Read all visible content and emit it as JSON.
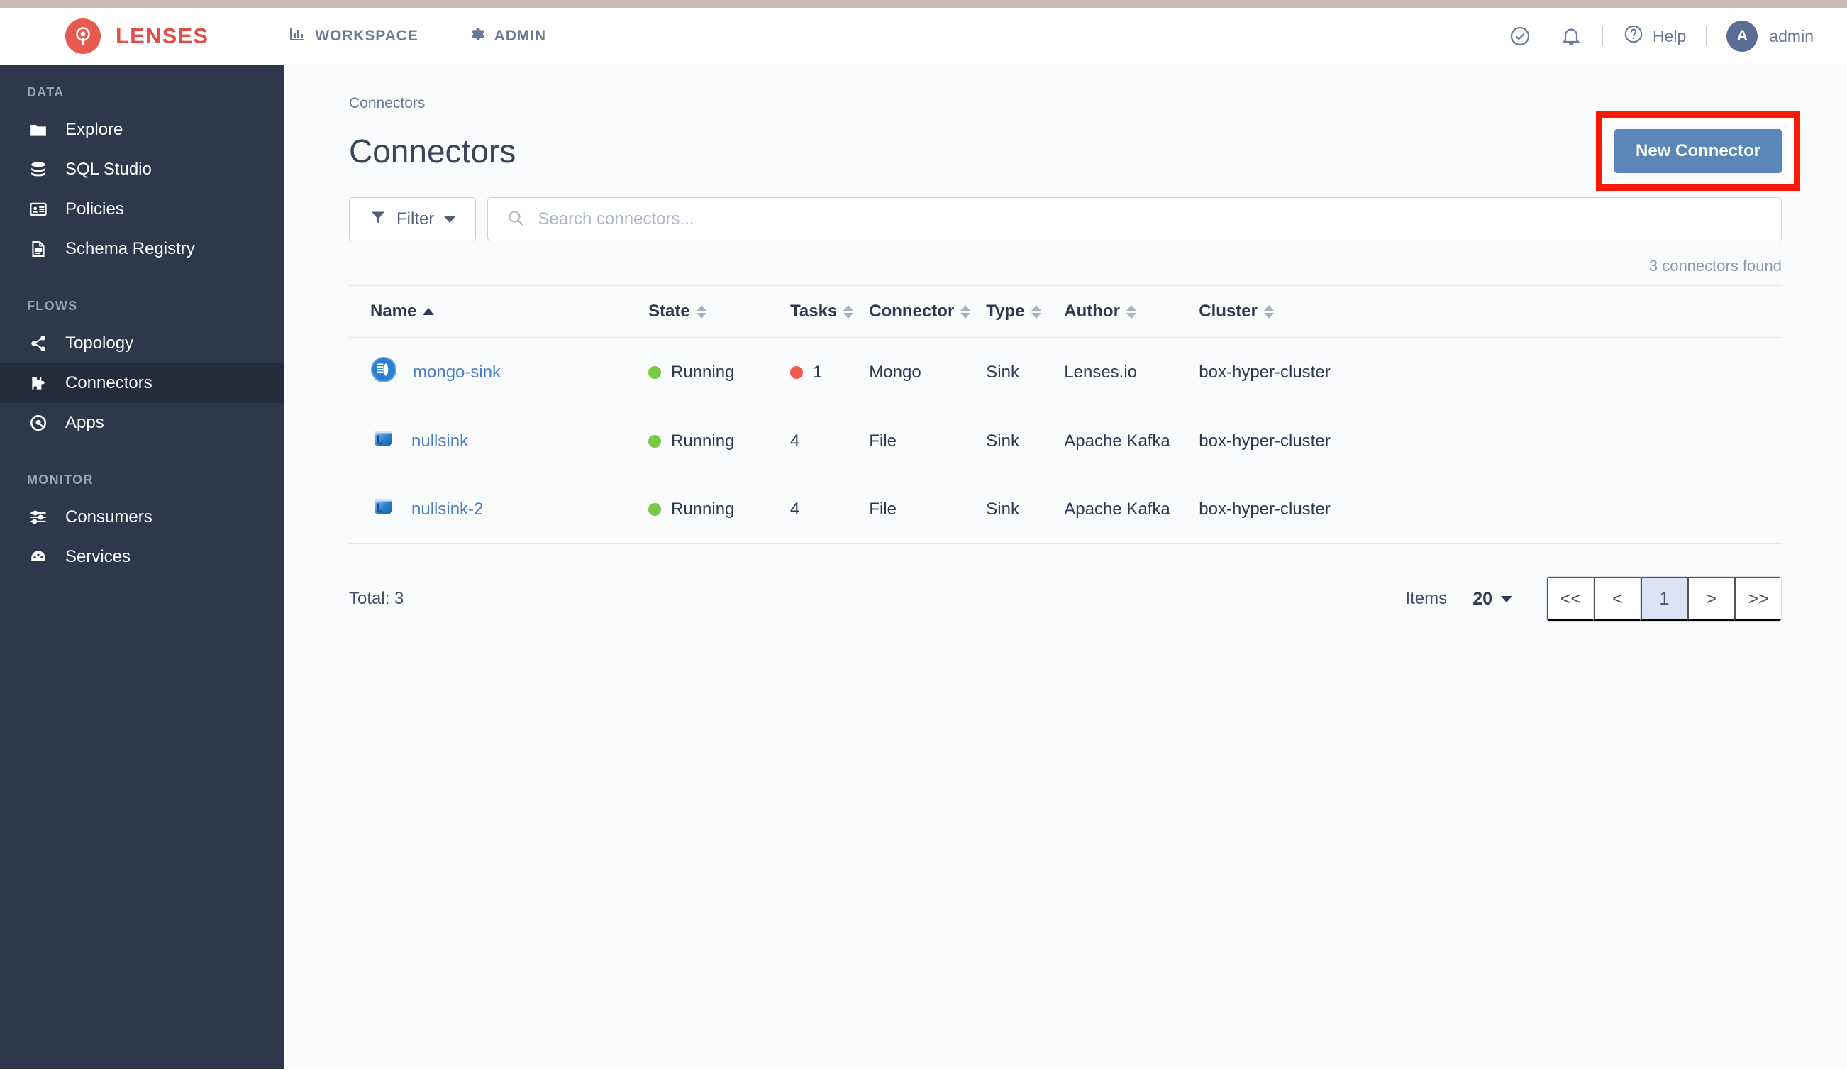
{
  "app": {
    "brand_name": "LENSES",
    "logo_icon": "lens-logo-icon",
    "brand_color": "#e0504a"
  },
  "header": {
    "nav": [
      {
        "label": "WORKSPACE",
        "icon": "bar-chart-icon"
      },
      {
        "label": "ADMIN",
        "icon": "gear-icon"
      }
    ],
    "status_icon": "check-circle-icon",
    "notifications_icon": "bell-icon",
    "help_label": "Help",
    "help_icon": "question-circle-icon",
    "user": {
      "initial": "A",
      "name": "admin"
    }
  },
  "sidebar": {
    "groups": [
      {
        "label": "DATA",
        "items": [
          {
            "label": "Explore",
            "icon": "folder-icon",
            "active": false
          },
          {
            "label": "SQL Studio",
            "icon": "database-icon",
            "active": false
          },
          {
            "label": "Policies",
            "icon": "id-card-icon",
            "active": false
          },
          {
            "label": "Schema Registry",
            "icon": "document-icon",
            "active": false
          }
        ]
      },
      {
        "label": "FLOWS",
        "items": [
          {
            "label": "Topology",
            "icon": "share-network-icon",
            "active": false
          },
          {
            "label": "Connectors",
            "icon": "puzzle-piece-icon",
            "active": true
          },
          {
            "label": "Apps",
            "icon": "apps-circle-icon",
            "active": false
          }
        ]
      },
      {
        "label": "MONITOR",
        "items": [
          {
            "label": "Consumers",
            "icon": "sliders-icon",
            "active": false
          },
          {
            "label": "Services",
            "icon": "gauge-icon",
            "active": false
          }
        ]
      }
    ]
  },
  "main": {
    "breadcrumb": "Connectors",
    "page_title": "Connectors",
    "new_connector_label": "New Connector",
    "new_connector_color": "#5b87b8",
    "annotation_color": "#fc1905",
    "filter_label": "Filter",
    "search_placeholder": "Search connectors...",
    "search_value": "",
    "found_text": "3 connectors found",
    "table": {
      "columns": [
        {
          "label": "Name",
          "sort": "asc"
        },
        {
          "label": "State",
          "sort": "none"
        },
        {
          "label": "Tasks",
          "sort": "none"
        },
        {
          "label": "Connector",
          "sort": "none"
        },
        {
          "label": "Type",
          "sort": "none"
        },
        {
          "label": "Author",
          "sort": "none"
        },
        {
          "label": "Cluster",
          "sort": "none"
        }
      ],
      "rows": [
        {
          "icon": "mongodb-connector-icon",
          "name": "mongo-sink",
          "state": "Running",
          "state_color": "#7ac943",
          "tasks": "1",
          "tasks_color": "#ef5a52",
          "connector": "Mongo",
          "type": "Sink",
          "author": "Lenses.io",
          "cluster": "box-hyper-cluster"
        },
        {
          "icon": "file-connector-icon",
          "name": "nullsink",
          "state": "Running",
          "state_color": "#7ac943",
          "tasks": "4",
          "tasks_color": "",
          "connector": "File",
          "type": "Sink",
          "author": "Apache Kafka",
          "cluster": "box-hyper-cluster"
        },
        {
          "icon": "file-connector-icon",
          "name": "nullsink-2",
          "state": "Running",
          "state_color": "#7ac943",
          "tasks": "4",
          "tasks_color": "",
          "connector": "File",
          "type": "Sink",
          "author": "Apache Kafka",
          "cluster": "box-hyper-cluster"
        }
      ]
    },
    "footer": {
      "total_label": "Total: 3",
      "items_label": "Items",
      "items_per_page": "20",
      "pager": [
        {
          "label": "<<",
          "active": false
        },
        {
          "label": "<",
          "active": false
        },
        {
          "label": "1",
          "active": true
        },
        {
          "label": ">",
          "active": false
        },
        {
          "label": ">>",
          "active": false
        }
      ]
    }
  }
}
